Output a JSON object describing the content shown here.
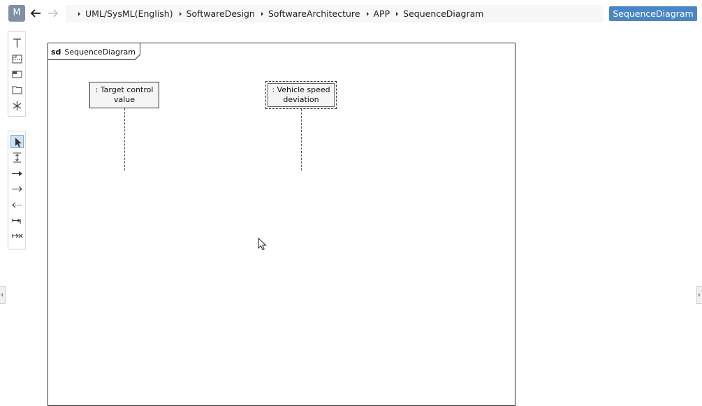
{
  "app": {
    "logo_letter": "M",
    "title_button": "SequenceDiagram"
  },
  "navigation": {
    "back_icon": "arrow-left-icon",
    "forward_icon": "arrow-right-icon",
    "forward_enabled": false
  },
  "breadcrumb": [
    {
      "label": "UML/SysML(English)"
    },
    {
      "label": "SoftwareDesign"
    },
    {
      "label": "SoftwareArchitecture"
    },
    {
      "label": "APP"
    },
    {
      "label": "SequenceDiagram"
    }
  ],
  "palette_top": [
    {
      "name": "lifeline-tool-icon"
    },
    {
      "name": "combined-fragment-tool-icon"
    },
    {
      "name": "interaction-use-tool-icon"
    },
    {
      "name": "frame-tool-icon"
    },
    {
      "name": "stop-tool-icon"
    }
  ],
  "palette_bottom": [
    {
      "name": "select-pointer-icon",
      "active": true
    },
    {
      "name": "space-resize-icon"
    },
    {
      "name": "sync-message-icon"
    },
    {
      "name": "async-message-icon"
    },
    {
      "name": "reply-message-icon"
    },
    {
      "name": "found-message-icon"
    },
    {
      "name": "lost-message-icon"
    }
  ],
  "diagram": {
    "frame_keyword": "sd",
    "frame_name": "SequenceDiagram",
    "lifelines": [
      {
        "label_line1": ": Target control",
        "label_line2": "value",
        "selected": false
      },
      {
        "label_line1": ": Vehicle speed",
        "label_line2": "deviation",
        "selected": true
      }
    ]
  },
  "colors": {
    "accent": "#4a86c6",
    "logo_bg": "#7e8fa6",
    "selection_bg": "#cfe2f5"
  }
}
